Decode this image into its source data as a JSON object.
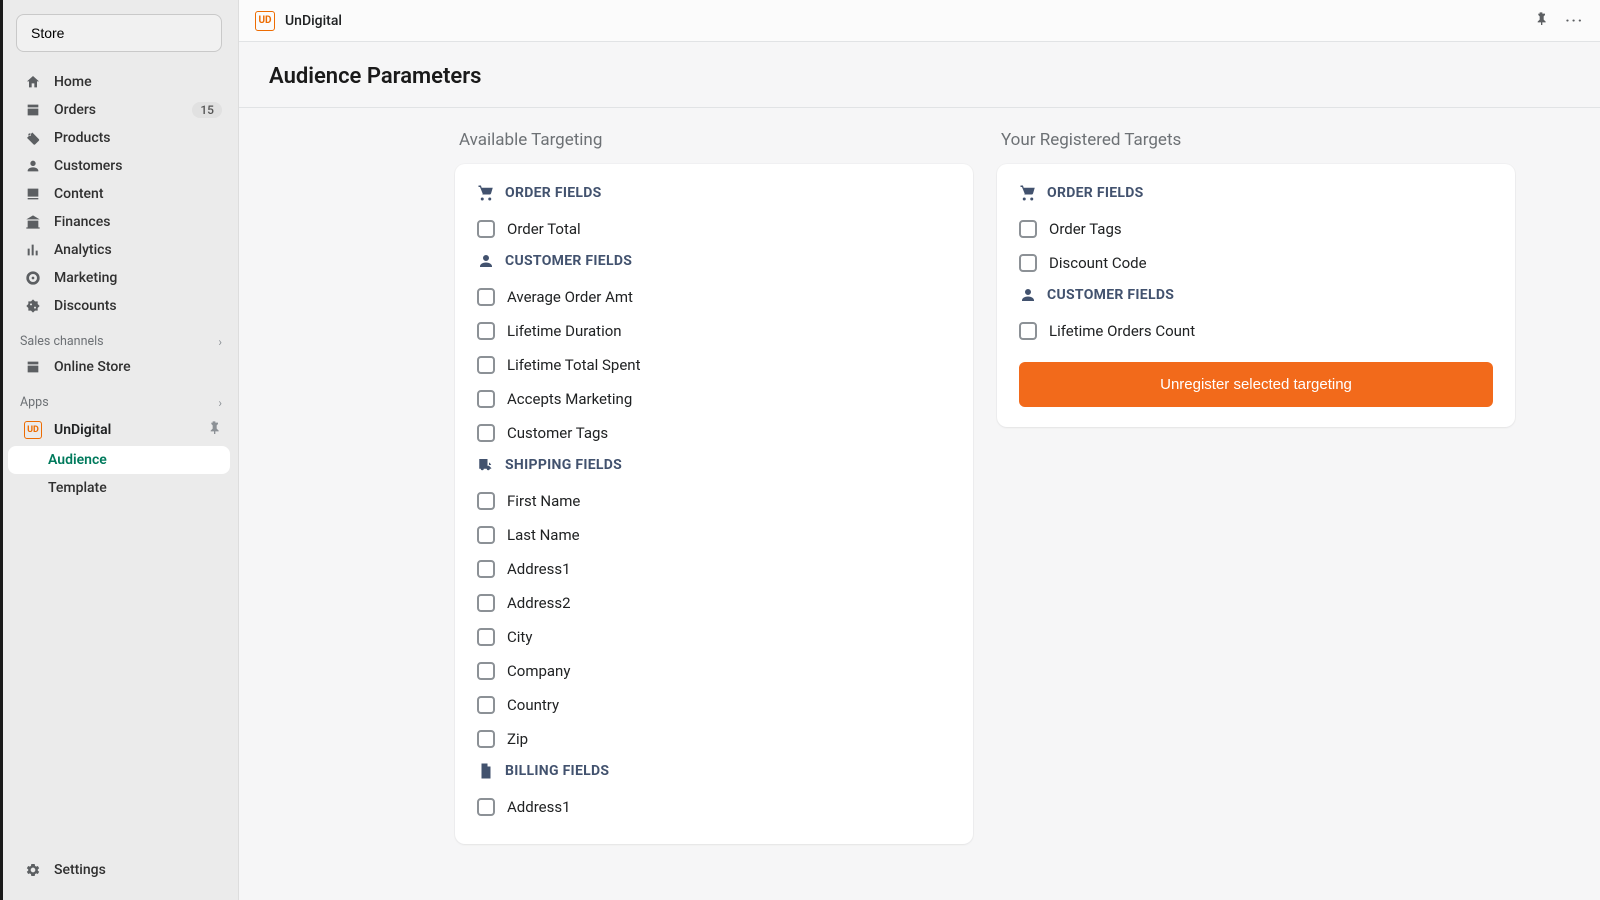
{
  "sidebar": {
    "store_button": "Store",
    "nav": [
      {
        "icon": "home-icon",
        "label": "Home"
      },
      {
        "icon": "orders-icon",
        "label": "Orders",
        "badge": "15"
      },
      {
        "icon": "products-icon",
        "label": "Products"
      },
      {
        "icon": "customers-icon",
        "label": "Customers"
      },
      {
        "icon": "content-icon",
        "label": "Content"
      },
      {
        "icon": "finances-icon",
        "label": "Finances"
      },
      {
        "icon": "analytics-icon",
        "label": "Analytics"
      },
      {
        "icon": "marketing-icon",
        "label": "Marketing"
      },
      {
        "icon": "discounts-icon",
        "label": "Discounts"
      }
    ],
    "sales_channels_label": "Sales channels",
    "online_store_label": "Online Store",
    "apps_label": "Apps",
    "app_name": "UnDigital",
    "sub_items": [
      {
        "label": "Audience",
        "active": true
      },
      {
        "label": "Template",
        "active": false
      }
    ],
    "settings_label": "Settings"
  },
  "topbar": {
    "app_title": "UnDigital"
  },
  "page": {
    "title": "Audience Parameters",
    "available_title": "Available Targeting",
    "registered_title": "Your Registered Targets",
    "unregister_button": "Unregister selected targeting"
  },
  "available": [
    {
      "type": "group",
      "icon": "cart-icon",
      "label": "ORDER FIELDS"
    },
    {
      "type": "field",
      "label": "Order Total"
    },
    {
      "type": "group",
      "icon": "person-icon",
      "label": "CUSTOMER FIELDS"
    },
    {
      "type": "field",
      "label": "Average Order Amt"
    },
    {
      "type": "field",
      "label": "Lifetime Duration"
    },
    {
      "type": "field",
      "label": "Lifetime Total Spent"
    },
    {
      "type": "field",
      "label": "Accepts Marketing"
    },
    {
      "type": "field",
      "label": "Customer Tags"
    },
    {
      "type": "group",
      "icon": "truck-icon",
      "label": "SHIPPING FIELDS"
    },
    {
      "type": "field",
      "label": "First Name"
    },
    {
      "type": "field",
      "label": "Last Name"
    },
    {
      "type": "field",
      "label": "Address1"
    },
    {
      "type": "field",
      "label": "Address2"
    },
    {
      "type": "field",
      "label": "City"
    },
    {
      "type": "field",
      "label": "Company"
    },
    {
      "type": "field",
      "label": "Country"
    },
    {
      "type": "field",
      "label": "Zip"
    },
    {
      "type": "group",
      "icon": "file-icon",
      "label": "BILLING FIELDS"
    },
    {
      "type": "field",
      "label": "Address1"
    }
  ],
  "registered": [
    {
      "type": "group",
      "icon": "cart-icon",
      "label": "ORDER FIELDS"
    },
    {
      "type": "field",
      "label": "Order Tags"
    },
    {
      "type": "field",
      "label": "Discount Code"
    },
    {
      "type": "group",
      "icon": "person-icon",
      "label": "CUSTOMER FIELDS"
    },
    {
      "type": "field",
      "label": "Lifetime Orders Count"
    }
  ]
}
